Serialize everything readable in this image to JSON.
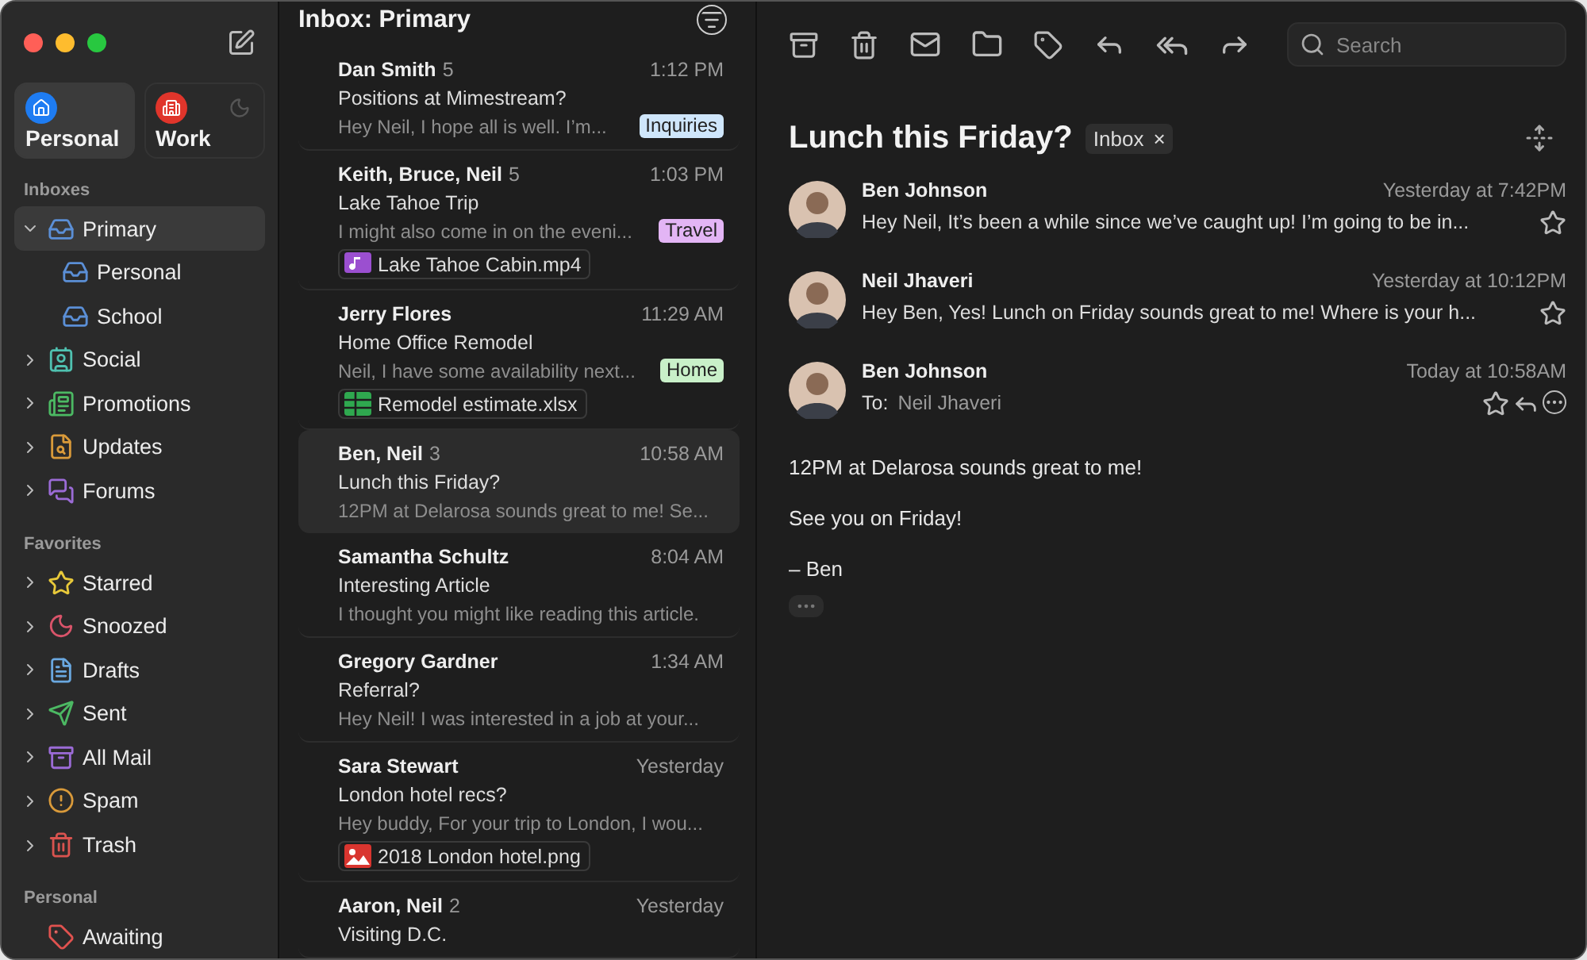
{
  "sidebar": {
    "accounts": [
      {
        "label": "Personal",
        "selected": true
      },
      {
        "label": "Work",
        "selected": false
      }
    ],
    "sections": [
      {
        "title": "Inboxes",
        "items": [
          {
            "label": "Primary",
            "color": "#5b8fd6",
            "expanded": true,
            "selected": true,
            "children": [
              {
                "label": "Personal",
                "color": "#5b8fd6",
                "selected": false
              },
              {
                "label": "School",
                "color": "#5b8fd6",
                "selected": false
              }
            ]
          },
          {
            "label": "Social",
            "color": "#4fc1b0",
            "expanded": false,
            "selected": false
          },
          {
            "label": "Promotions",
            "color": "#4cb963",
            "expanded": false,
            "selected": false
          },
          {
            "label": "Updates",
            "color": "#d99a3a",
            "expanded": false,
            "selected": false
          },
          {
            "label": "Forums",
            "color": "#9b6bd6",
            "expanded": false,
            "selected": false
          }
        ]
      },
      {
        "title": "Favorites",
        "items": [
          {
            "label": "Starred",
            "color": "#e8c93a",
            "expanded": false,
            "selected": false
          },
          {
            "label": "Snoozed",
            "color": "#d9546a",
            "expanded": false,
            "selected": false
          },
          {
            "label": "Drafts",
            "color": "#6aa8e0",
            "expanded": false,
            "selected": false
          },
          {
            "label": "Sent",
            "color": "#4cb963",
            "expanded": false,
            "selected": false
          },
          {
            "label": "All Mail",
            "color": "#9b6bd6",
            "expanded": false,
            "selected": false
          },
          {
            "label": "Spam",
            "color": "#d99a3a",
            "expanded": false,
            "selected": false
          },
          {
            "label": "Trash",
            "color": "#d9534f",
            "expanded": false,
            "selected": false
          }
        ]
      },
      {
        "title": "Personal",
        "items": [
          {
            "label": "Awaiting",
            "color": "#e0524f",
            "selected": false
          }
        ]
      }
    ]
  },
  "mail_list": {
    "title": "Inbox: Primary",
    "rows": [
      {
        "sender": "Dan Smith",
        "count": "5",
        "time": "1:12 PM",
        "subject": "Positions at Mimestream?",
        "preview": "Hey Neil, I hope all is well. I’m...",
        "tag": {
          "label": "Inquiries",
          "color": "#cfe6fb"
        },
        "selected": false
      },
      {
        "sender": "Keith, Bruce, Neil",
        "count": "5",
        "time": "1:03 PM",
        "subject": "Lake Tahoe Trip",
        "preview": "I might also come in on the eveni...",
        "tag": {
          "label": "Travel",
          "color": "#e3b5f5"
        },
        "attachment": {
          "name": "Lake Tahoe Cabin.mp4",
          "kind": "video"
        },
        "selected": false
      },
      {
        "sender": "Jerry Flores",
        "time": "11:29 AM",
        "subject": "Home Office Remodel",
        "preview": "Neil, I have some availability next...",
        "tag": {
          "label": "Home",
          "color": "#c9f0c9"
        },
        "attachment": {
          "name": "Remodel estimate.xlsx",
          "kind": "sheet"
        },
        "selected": false
      },
      {
        "sender": "Ben, Neil",
        "count": "3",
        "time": "10:58 AM",
        "subject": "Lunch this Friday?",
        "preview": "12PM at Delarosa sounds great to me! Se...",
        "selected": true
      },
      {
        "sender": "Samantha Schultz",
        "time": "8:04 AM",
        "subject": "Interesting Article",
        "preview": "I thought you might like reading this article.",
        "selected": false
      },
      {
        "sender": "Gregory Gardner",
        "time": "1:34 AM",
        "subject": "Referral?",
        "preview": "Hey Neil! I was interested in a job at your...",
        "selected": false
      },
      {
        "sender": "Sara Stewart",
        "time": "Yesterday",
        "subject": "London hotel recs?",
        "preview": "Hey buddy, For your trip to London, I wou...",
        "attachment": {
          "name": "2018 London hotel.png",
          "kind": "image"
        },
        "selected": false
      },
      {
        "sender": "Aaron, Neil",
        "count": "2",
        "time": "Yesterday",
        "subject": "Visiting D.C.",
        "selected": false
      }
    ]
  },
  "reader": {
    "search": {
      "placeholder": "Search"
    },
    "subject": "Lunch this Friday?",
    "label": "Inbox",
    "remove_label": "×",
    "messages": [
      {
        "kind": "collapsed",
        "sender": "Ben Johnson",
        "time": "Yesterday at 7:42PM",
        "preview": "Hey Neil, It’s been a while since we’ve caught up! I’m going to be in...",
        "starred": false
      },
      {
        "kind": "collapsed",
        "sender": "Neil Jhaveri",
        "time": "Yesterday at 10:12PM",
        "preview": "Hey Ben, Yes! Lunch on Friday sounds great to me! Where is your h...",
        "starred": false
      },
      {
        "kind": "expanded",
        "sender": "Ben Johnson",
        "time": "Today at 10:58AM",
        "to_label": "To:",
        "to": "Neil Jhaveri",
        "starred": false,
        "body": [
          "12PM at Delarosa sounds great to me!",
          "See you on Friday!",
          "– Ben"
        ]
      }
    ]
  }
}
